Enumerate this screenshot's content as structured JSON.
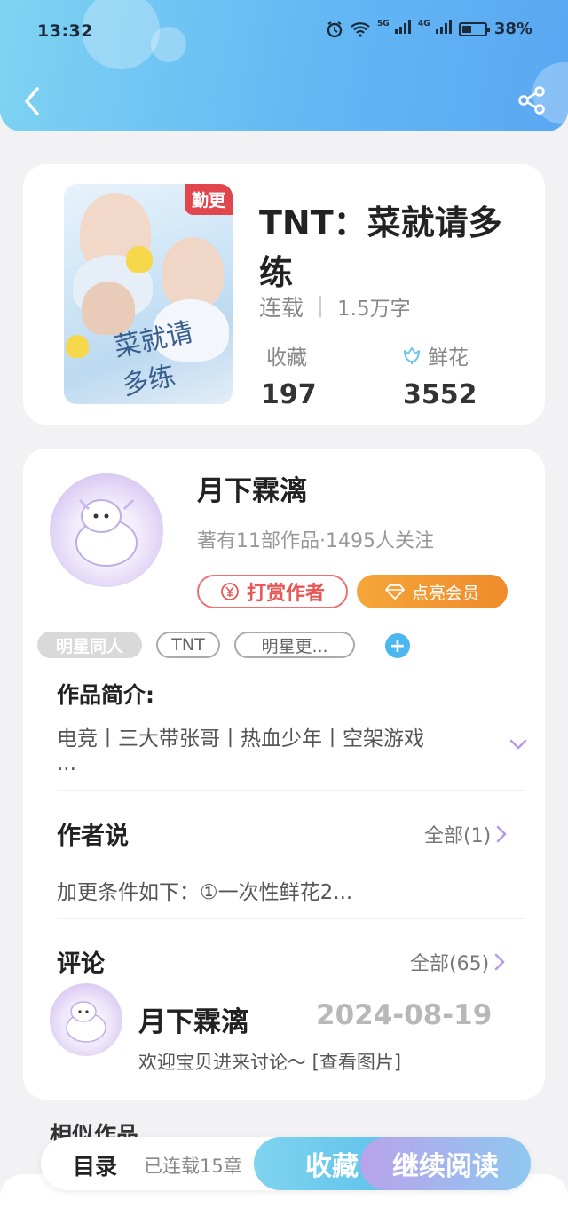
{
  "status_bar": {
    "time": "13:32",
    "net1": "5G",
    "net2": "4G",
    "battery": "38%"
  },
  "book": {
    "badge": "勤更",
    "title": "TNT：菜就请多练",
    "status": "连载",
    "word_count": "1.5万字",
    "favorites_label": "收藏",
    "favorites_value": "197",
    "flowers_label": "鲜花",
    "flowers_value": "3552"
  },
  "author": {
    "name": "月下霖漓",
    "stats": "著有11部作品·1495人关注",
    "tip_label": "打赏作者",
    "vip_label": "点亮会员"
  },
  "tags": [
    "明星同人",
    "TNT",
    "明星更..."
  ],
  "intro": {
    "title": "作品简介:",
    "text": "电竞丨三大带张哥丨热血少年丨空架游戏",
    "ellipsis": "..."
  },
  "author_say": {
    "title": "作者说",
    "all_label": "全部(1)",
    "text": "加更条件如下：①一次性鲜花2..."
  },
  "comments": {
    "title": "评论",
    "all_label": "全部(65)",
    "first": {
      "name": "月下霖漓",
      "date": "2024-08-19",
      "text": "欢迎宝贝进来讨论～ [查看图片]"
    }
  },
  "similar_title": "相似作品",
  "bottom": {
    "toc_label": "目录",
    "serial_text": "已连载15章",
    "fav_label": "收藏",
    "read_label": "继续阅读"
  },
  "colors": {
    "header_start": "#7fd3f2",
    "header_end": "#5aa7f2",
    "tip": "#e85656",
    "vip": "#f08a2a",
    "accent_blue": "#4cb6ee",
    "purple": "#b9a3ea"
  }
}
